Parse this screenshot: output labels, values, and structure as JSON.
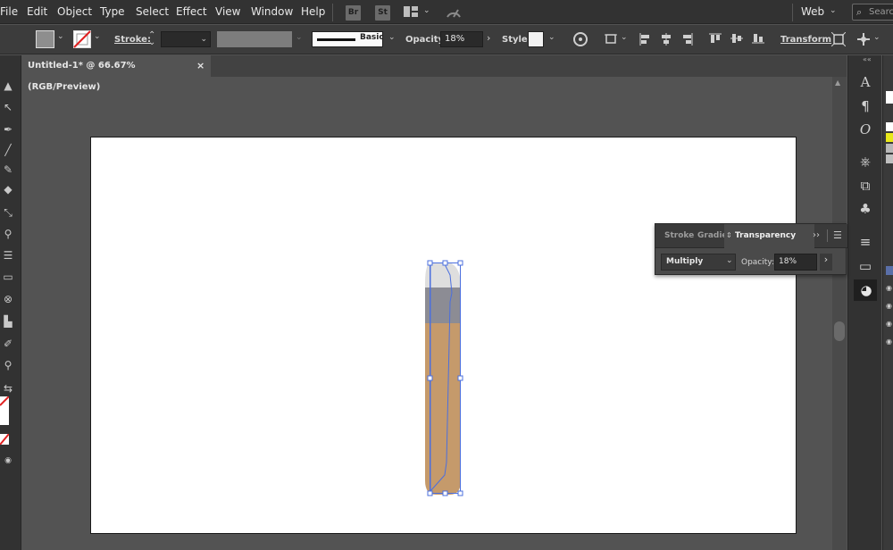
{
  "menubar": {
    "items": [
      "File",
      "Edit",
      "Object",
      "Type",
      "Select",
      "Effect",
      "View",
      "Window",
      "Help"
    ],
    "bridge_label": "Br",
    "stock_label": "St",
    "workspace": "Web",
    "search_placeholder": "Search"
  },
  "controlbar": {
    "stroke_label": "Stroke:",
    "brush_label": "Basic",
    "opacity_label": "Opacity:",
    "opacity_value": "18%",
    "style_label": "Style:",
    "transform_label": "Transform"
  },
  "document": {
    "tab_title": "Untitled-1* @ 66.67% (RGB/Preview)",
    "close_glyph": "×"
  },
  "transparency_panel": {
    "tabs": [
      "Stroke",
      "Gradie",
      "Transparency"
    ],
    "blend_mode": "Multiply",
    "opacity_label": "Opacity:",
    "opacity_value": "18%"
  },
  "colors": {
    "menubar_bg": "#323232",
    "workspace_bg": "#535353",
    "artboard_bg": "#ffffff",
    "shape_fill": "#c59a6b",
    "shape_top": "#dedede",
    "shape_band": "#8c8c94",
    "selection": "#4b6fde"
  }
}
